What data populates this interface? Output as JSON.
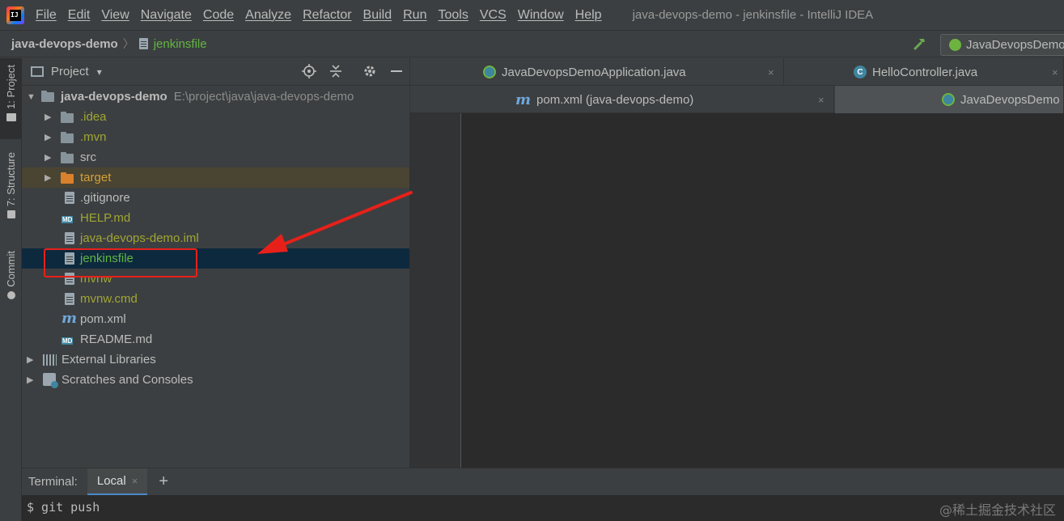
{
  "menu": {
    "items": [
      "File",
      "Edit",
      "View",
      "Navigate",
      "Code",
      "Analyze",
      "Refactor",
      "Build",
      "Run",
      "Tools",
      "VCS",
      "Window",
      "Help"
    ],
    "window_title": "java-devops-demo - jenkinsfile - IntelliJ IDEA"
  },
  "navbar": {
    "project": "java-devops-demo",
    "separator": "〉",
    "file": "jenkinsfile",
    "run_config": "JavaDevopsDemo"
  },
  "toolstrip": {
    "project_tab": "1: Project",
    "structure_tab": "7: Structure",
    "commit_tab": "Commit"
  },
  "project_panel": {
    "title": "Project",
    "caret": "▾",
    "tree": [
      {
        "label": "java-devops-demo",
        "path": "E:\\project\\java\\java-devops-demo"
      },
      {
        "label": ".idea"
      },
      {
        "label": ".mvn"
      },
      {
        "label": "src"
      },
      {
        "label": "target"
      },
      {
        "label": ".gitignore"
      },
      {
        "label": "HELP.md"
      },
      {
        "label": "java-devops-demo.iml"
      },
      {
        "label": "jenkinsfile"
      },
      {
        "label": "mvnw"
      },
      {
        "label": "mvnw.cmd"
      },
      {
        "label": "pom.xml"
      },
      {
        "label": "README.md"
      },
      {
        "label": "External Libraries"
      },
      {
        "label": "Scratches and Consoles"
      }
    ],
    "icons": {
      "md": "MD",
      "maven": "m"
    }
  },
  "editor": {
    "tabs_row1": [
      {
        "label": "JavaDevopsDemoApplication.java"
      },
      {
        "label": "HelloController.java"
      }
    ],
    "tabs_row2": [
      {
        "label": "pom.xml (java-devops-demo)"
      },
      {
        "label": "JavaDevopsDemo"
      }
    ],
    "close_glyph": "×",
    "class_glyph": "C"
  },
  "terminal": {
    "title": "Terminal:",
    "tab": "Local",
    "close_glyph": "×",
    "add_glyph": "+",
    "line": "$ git push",
    "watermark": "@稀土掘金技术社区"
  },
  "colors": {
    "accent": "#4a88c7",
    "annotation": "#e8201a",
    "selection": "#0d293e",
    "vcs_new": "#62b543",
    "vcs_untracked": "#a0a633",
    "ignored": "#d2a13a"
  }
}
